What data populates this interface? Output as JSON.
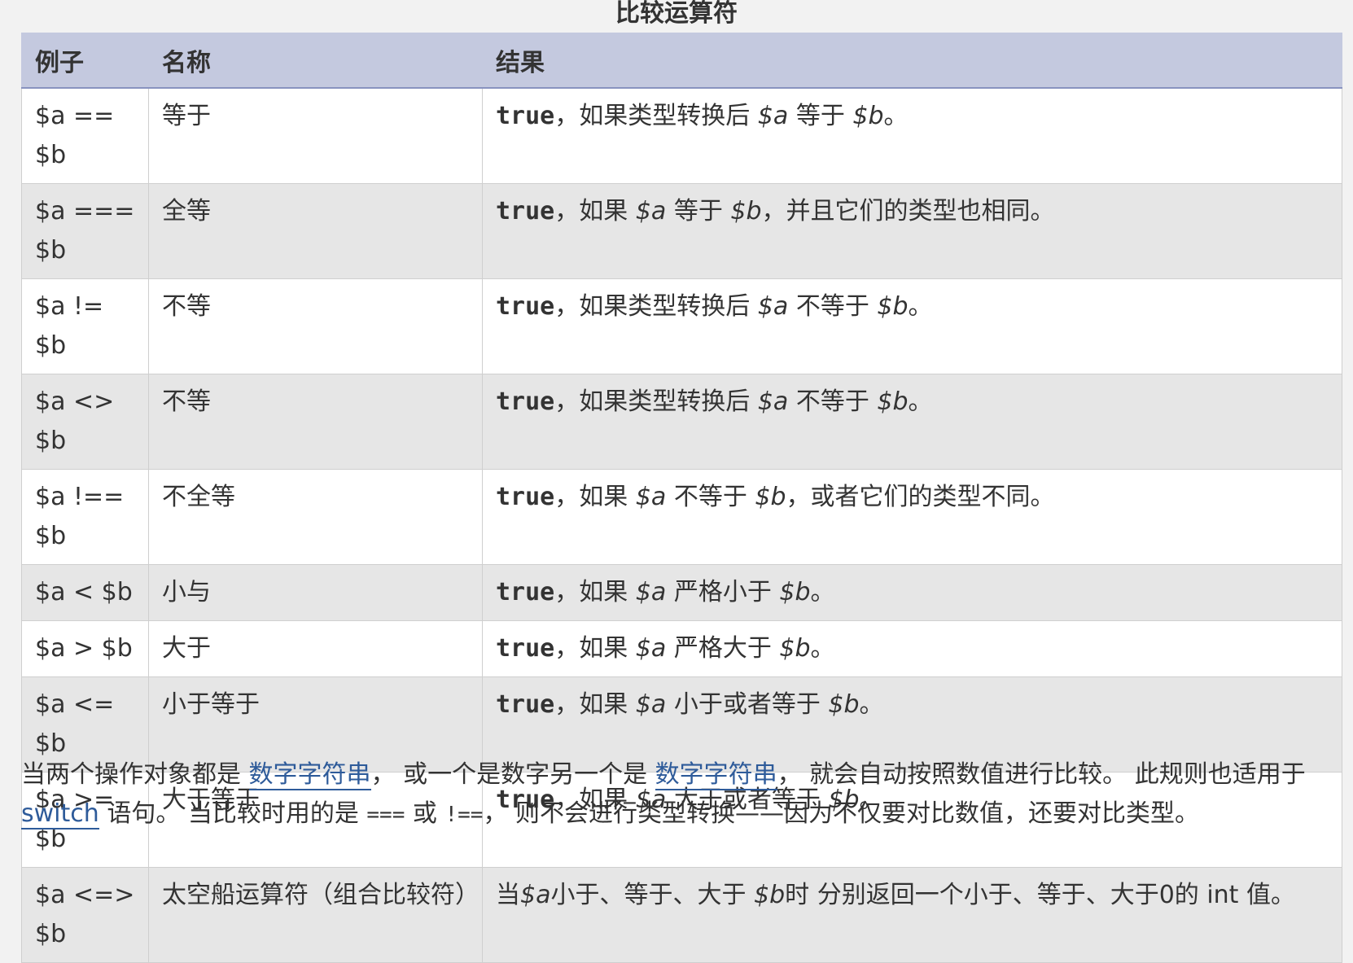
{
  "caption": "比较运算符",
  "headers": {
    "example": "例子",
    "name": "名称",
    "result": "结果"
  },
  "rows": [
    {
      "example": "$a == $b",
      "name": "等于",
      "kw": "true",
      "a": "，如果类型转换后 ",
      "v1": "$a",
      "b": " 等于 ",
      "v2": "$b",
      "c": "。"
    },
    {
      "example": "$a === $b",
      "name": "全等",
      "kw": "true",
      "a": "，如果 ",
      "v1": "$a",
      "b": " 等于 ",
      "v2": "$b",
      "c": "，并且它们的类型也相同。"
    },
    {
      "example": "$a != $b",
      "name": "不等",
      "kw": "true",
      "a": "，如果类型转换后 ",
      "v1": "$a",
      "b": " 不等于 ",
      "v2": "$b",
      "c": "。"
    },
    {
      "example": "$a <> $b",
      "name": "不等",
      "kw": "true",
      "a": "，如果类型转换后 ",
      "v1": "$a",
      "b": " 不等于 ",
      "v2": "$b",
      "c": "。"
    },
    {
      "example": "$a !== $b",
      "name": "不全等",
      "kw": "true",
      "a": "，如果 ",
      "v1": "$a",
      "b": " 不等于 ",
      "v2": "$b",
      "c": "，或者它们的类型不同。"
    },
    {
      "example": "$a < $b",
      "name": "小与",
      "kw": "true",
      "a": "，如果 ",
      "v1": "$a",
      "b": " 严格小于 ",
      "v2": "$b",
      "c": "。"
    },
    {
      "example": "$a > $b",
      "name": "大于",
      "kw": "true",
      "a": "，如果 ",
      "v1": "$a",
      "b": " 严格大于 ",
      "v2": "$b",
      "c": "。"
    },
    {
      "example": "$a <= $b",
      "name": "小于等于",
      "kw": "true",
      "a": "，如果 ",
      "v1": "$a",
      "b": " 小于或者等于 ",
      "v2": "$b",
      "c": "。"
    },
    {
      "example": "$a >= $b",
      "name": "大于等于",
      "kw": "true",
      "a": "，如果 ",
      "v1": "$a",
      "b": " 大于或者等于 ",
      "v2": "$b",
      "c": "。"
    },
    {
      "example": "$a <=> $b",
      "name": "太空船运算符（组合比较符）",
      "kw": "",
      "a": "当",
      "v1": "$a",
      "b": "小于、等于、大于 ",
      "v2": "$b",
      "c": "时 分别返回一个小于、等于、大于0的 int 值。"
    }
  ],
  "note": {
    "t1": "当两个操作对象都是 ",
    "link1": "数字字符串",
    "t2": "， 或一个是数字另一个是 ",
    "link2": "数字字符串",
    "t3": "， 就会自动按照数值进行比较。 此规则也适用于 ",
    "link3": "switch",
    "t4": " 语句。 当比较时用的是 ",
    "code1": "===",
    "t5": " 或 ",
    "code2": "!==",
    "t6": "， 则不会进行类型转换——因为不仅要对比数值，还要对比类型。"
  }
}
